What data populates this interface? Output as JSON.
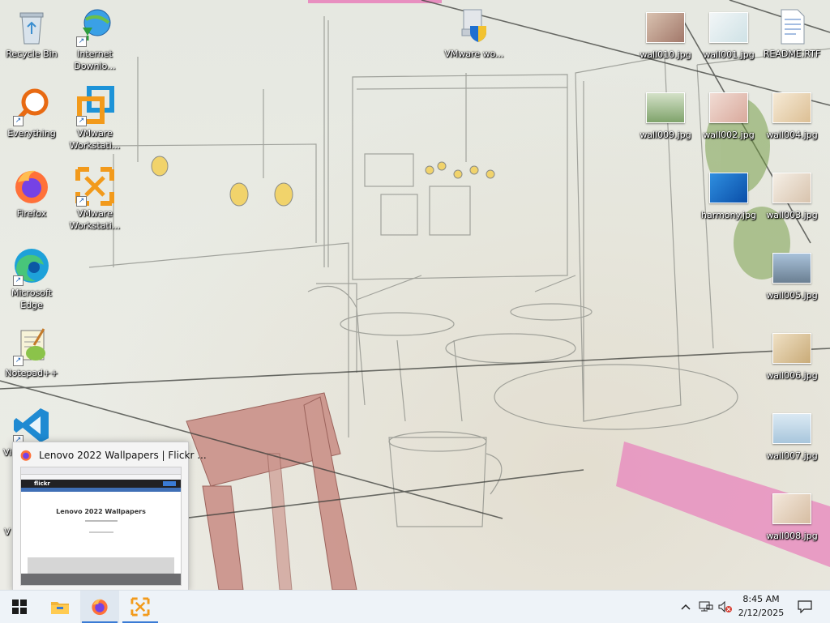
{
  "desktop": {
    "left_icons": [
      {
        "name": "recycle-bin",
        "label": "Recycle Bin"
      },
      {
        "name": "internet-download-manager",
        "label": "Internet Downlo..."
      },
      {
        "name": "everything",
        "label": "Everything"
      },
      {
        "name": "vmware-workstation-1",
        "label": "VMware Workstati..."
      },
      {
        "name": "firefox",
        "label": "Firefox"
      },
      {
        "name": "vmware-workstation-2",
        "label": "VMware Workstati..."
      },
      {
        "name": "microsoft-edge",
        "label": "Microsoft Edge"
      },
      {
        "name": "notepad-plus-plus",
        "label": "Notepad++"
      },
      {
        "name": "vscode",
        "label": "Vi"
      },
      {
        "name": "hidden-item",
        "label": "V"
      }
    ],
    "top_icon": {
      "label": "VMware wo..."
    },
    "right_icons": [
      {
        "label": "wall010.jpg",
        "color": "#c89a7f"
      },
      {
        "label": "wall001.jpg",
        "color": "#e8eef0"
      },
      {
        "label": "README.RTF",
        "color": "#ffffff"
      },
      {
        "label": "wall009.jpg",
        "color": "#9bb99a"
      },
      {
        "label": "wall002.jpg",
        "color": "#e8c9c0"
      },
      {
        "label": "wall004.jpg",
        "color": "#f0dcc0"
      },
      {
        "label": "harmony.jpg",
        "color": "#1a73c8"
      },
      {
        "label": "wall003.jpg",
        "color": "#efe6da"
      },
      {
        "label": "wall005.jpg",
        "color": "#8aa4bd"
      },
      {
        "label": "wall006.jpg",
        "color": "#e2cfa9"
      },
      {
        "label": "wall007.jpg",
        "color": "#c6dbe9"
      },
      {
        "label": "wall008.jpg",
        "color": "#e8d7c6"
      }
    ]
  },
  "preview": {
    "title": "Lenovo 2022 Wallpapers | Flickr ...",
    "page_heading": "Lenovo 2022 Wallpapers",
    "site": "flickr"
  },
  "taskbar": {
    "time": "8:45 AM",
    "date": "2/12/2025"
  },
  "colors": {
    "taskbar": "#eef3f8",
    "accent": "#3a7bd5",
    "pink": "#e88fc0"
  }
}
